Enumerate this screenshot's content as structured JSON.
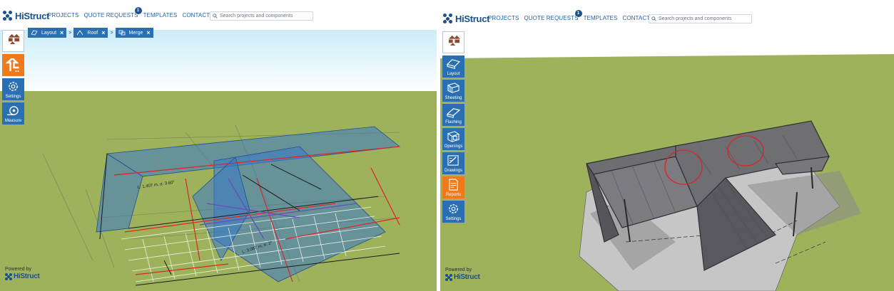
{
  "app": {
    "logo": "HiStruct",
    "nav": [
      "PROJECTS",
      "QUOTE REQUESTS",
      "TEMPLATES",
      "CONTACTS"
    ],
    "quote_badge": "1",
    "search_placeholder": "Search projects and components",
    "powered_by": "Powered by"
  },
  "left": {
    "crumbs": [
      {
        "label": "Layout",
        "close": "×"
      },
      {
        "label": "Roof",
        "close": "×"
      },
      {
        "label": "Merge",
        "close": "×"
      }
    ],
    "separator": ">",
    "tools": [
      "",
      "",
      "Settings",
      "Measure"
    ],
    "annotations": [
      "L: 1.407 m, α: 3.60°",
      "L: 3.087 m, α: 2°"
    ]
  },
  "right": {
    "tools": [
      "",
      "Layout",
      "Sheeting",
      "Flashing",
      "Openings",
      "Drawings",
      "Reports",
      "Settings"
    ]
  },
  "colors": {
    "brand": "#1c4f8c",
    "link": "#1f65b0",
    "tool_blue": "#2a6fb2",
    "tool_orange": "#ef7a1c",
    "grass": "#9db25b",
    "sky_top": "#cfeef9",
    "roof_blue": "#3a78c9",
    "highlight_red": "#d9262a"
  }
}
